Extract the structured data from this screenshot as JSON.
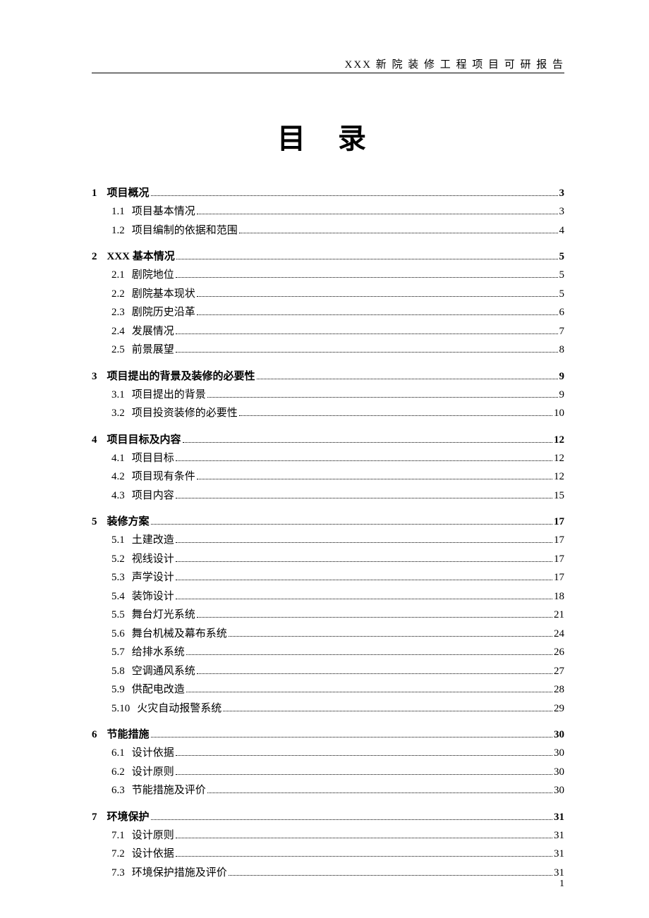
{
  "header": "XXX 新 院 装 修 工 程 项 目 可 研 报 告",
  "title": "目 录",
  "page_number": "1",
  "toc": [
    {
      "level": 1,
      "num": "1",
      "text": "项目概况",
      "page": "3"
    },
    {
      "level": 2,
      "num": "1.1",
      "text": "项目基本情况",
      "page": "3"
    },
    {
      "level": 2,
      "num": "1.2",
      "text": "项目编制的依据和范围",
      "page": "4"
    },
    {
      "level": 1,
      "num": "2",
      "text": "XXX 基本情况",
      "page": "5"
    },
    {
      "level": 2,
      "num": "2.1",
      "text": "剧院地位",
      "page": "5"
    },
    {
      "level": 2,
      "num": "2.2",
      "text": "剧院基本现状",
      "page": "5"
    },
    {
      "level": 2,
      "num": "2.3",
      "text": "剧院历史沿革",
      "page": "6"
    },
    {
      "level": 2,
      "num": "2.4",
      "text": "发展情况",
      "page": "7"
    },
    {
      "level": 2,
      "num": "2.5",
      "text": "前景展望",
      "page": "8"
    },
    {
      "level": 1,
      "num": "3",
      "text": "项目提出的背景及装修的必要性",
      "page": "9"
    },
    {
      "level": 2,
      "num": "3.1",
      "text": "项目提出的背景",
      "page": "9"
    },
    {
      "level": 2,
      "num": "3.2",
      "text": "项目投资装修的必要性",
      "page": "10"
    },
    {
      "level": 1,
      "num": "4",
      "text": "项目目标及内容",
      "page": "12"
    },
    {
      "level": 2,
      "num": "4.1",
      "text": "项目目标",
      "page": "12"
    },
    {
      "level": 2,
      "num": "4.2",
      "text": "项目现有条件",
      "page": "12"
    },
    {
      "level": 2,
      "num": "4.3",
      "text": "项目内容",
      "page": "15"
    },
    {
      "level": 1,
      "num": "5",
      "text": "装修方案",
      "page": "17"
    },
    {
      "level": 2,
      "num": "5.1",
      "text": "土建改造",
      "page": "17"
    },
    {
      "level": 2,
      "num": "5.2",
      "text": "视线设计",
      "page": "17"
    },
    {
      "level": 2,
      "num": "5.3",
      "text": "声学设计",
      "page": "17"
    },
    {
      "level": 2,
      "num": "5.4",
      "text": "装饰设计",
      "page": "18"
    },
    {
      "level": 2,
      "num": "5.5",
      "text": "舞台灯光系统",
      "page": "21"
    },
    {
      "level": 2,
      "num": "5.6",
      "text": "舞台机械及幕布系统",
      "page": "24"
    },
    {
      "level": 2,
      "num": "5.7",
      "text": "给排水系统",
      "page": "26"
    },
    {
      "level": 2,
      "num": "5.8",
      "text": "空调通风系统",
      "page": "27"
    },
    {
      "level": 2,
      "num": "5.9",
      "text": "供配电改造",
      "page": "28"
    },
    {
      "level": 2,
      "num": "5.10",
      "text": "火灾自动报警系统",
      "page": "29"
    },
    {
      "level": 1,
      "num": "6",
      "text": "节能措施",
      "page": "30"
    },
    {
      "level": 2,
      "num": "6.1",
      "text": "设计依据",
      "page": "30"
    },
    {
      "level": 2,
      "num": "6.2",
      "text": "设计原则",
      "page": "30"
    },
    {
      "level": 2,
      "num": "6.3",
      "text": "节能措施及评价",
      "page": "30"
    },
    {
      "level": 1,
      "num": "7",
      "text": "环境保护",
      "page": "31"
    },
    {
      "level": 2,
      "num": "7.1",
      "text": "设计原则",
      "page": "31"
    },
    {
      "level": 2,
      "num": "7.2",
      "text": "设计依据",
      "page": "31"
    },
    {
      "level": 2,
      "num": "7.3",
      "text": "环境保护措施及评价",
      "page": "31"
    }
  ]
}
